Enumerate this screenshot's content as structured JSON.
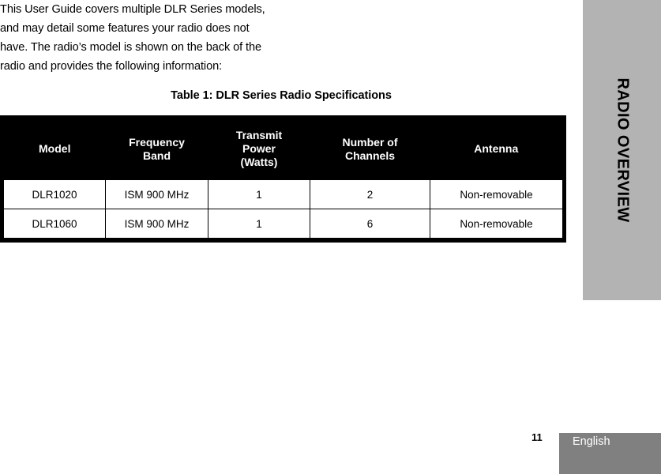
{
  "document": {
    "body_paragraph": "This User Guide covers multiple DLR Series models, and may detail some features your radio does not have. The radio’s model is shown on the back of the radio and provides the following information:",
    "table_caption": "Table 1: DLR Series Radio Specifications"
  },
  "table": {
    "headers": [
      "Model",
      "Frequency\nBand",
      "Transmit\nPower\n(Watts)",
      "Number of\nChannels",
      "Antenna"
    ],
    "rows": [
      {
        "model": "DLR1020",
        "frequency_band": "ISM 900 MHz",
        "transmit_power_watts": "1",
        "number_of_channels": "2",
        "antenna": "Non-removable"
      },
      {
        "model": "DLR1060",
        "frequency_band": "ISM 900 MHz",
        "transmit_power_watts": "1",
        "number_of_channels": "6",
        "antenna": "Non-removable"
      }
    ]
  },
  "chapter_tab": {
    "label": "RADIO OVERVIEW"
  },
  "footer": {
    "page_number": "11",
    "language": "English"
  },
  "colors": {
    "chapter_tab_background": "#b3b3b3",
    "footer_block_background": "#808080",
    "table_header_background": "#000000",
    "text": "#000000",
    "page_background": "#ffffff"
  }
}
